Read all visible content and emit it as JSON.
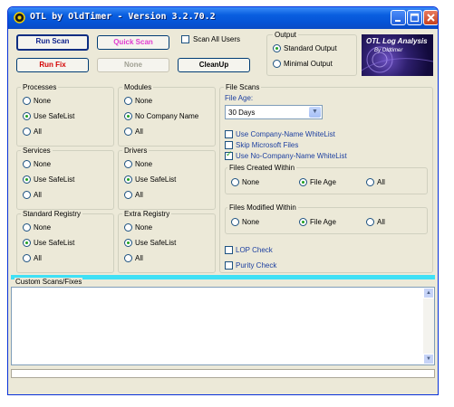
{
  "window": {
    "title": "OTL by OldTimer - Version 3.2.70.2",
    "minimize_icon": "minimize-icon",
    "maximize_icon": "maximize-icon",
    "close_icon": "close-icon"
  },
  "toolbar": {
    "run_scan": "Run Scan",
    "quick_scan": "Quick Scan",
    "run_fix": "Run Fix",
    "none": "None",
    "cleanup": "CleanUp",
    "scan_all_users": "Scan All Users",
    "colors": {
      "run_scan": "#0b1f8a",
      "quick_scan": "#e03bd0",
      "run_fix": "#d40000"
    }
  },
  "output": {
    "title": "Output",
    "options": [
      "Standard Output",
      "Minimal Output"
    ],
    "selected": "Standard Output"
  },
  "logo": {
    "text": "OTL Log Analysis",
    "subtext": "By Oldtimer"
  },
  "processes": {
    "title": "Processes",
    "options": [
      "None",
      "Use SafeList",
      "All"
    ],
    "selected": "Use SafeList"
  },
  "modules": {
    "title": "Modules",
    "options": [
      "None",
      "No Company Name",
      "All"
    ],
    "selected": "No Company Name"
  },
  "services": {
    "title": "Services",
    "options": [
      "None",
      "Use SafeList",
      "All"
    ],
    "selected": "Use SafeList"
  },
  "drivers": {
    "title": "Drivers",
    "options": [
      "None",
      "Use SafeList",
      "All"
    ],
    "selected": "Use SafeList"
  },
  "standard_registry": {
    "title": "Standard Registry",
    "options": [
      "None",
      "Use SafeList",
      "All"
    ],
    "selected": "Use SafeList"
  },
  "extra_registry": {
    "title": "Extra Registry",
    "options": [
      "None",
      "Use SafeList",
      "All"
    ],
    "selected": "Use SafeList"
  },
  "file_scans": {
    "title": "File Scans",
    "file_age_label": "File Age:",
    "file_age_value": "30 Days",
    "checks": [
      {
        "label": "Use Company-Name WhiteList",
        "checked": false
      },
      {
        "label": "Skip Microsoft Files",
        "checked": false
      },
      {
        "label": "Use No-Company-Name WhiteList",
        "checked": true
      }
    ],
    "created_within": {
      "title": "Files Created Within",
      "options": [
        "None",
        "File Age",
        "All"
      ],
      "selected": "File Age"
    },
    "modified_within": {
      "title": "Files Modified Within",
      "options": [
        "None",
        "File Age",
        "All"
      ],
      "selected": "File Age"
    },
    "lop_check": {
      "label": "LOP Check",
      "checked": false
    },
    "purity_check": {
      "label": "Purity Check",
      "checked": false
    }
  },
  "custom_scans": {
    "title": "Custom Scans/Fixes",
    "value": ""
  },
  "colors": {
    "window_bg": "#ece9d8",
    "titlebar": "#0553d6",
    "cyan_bar": "#3fe0f5"
  }
}
